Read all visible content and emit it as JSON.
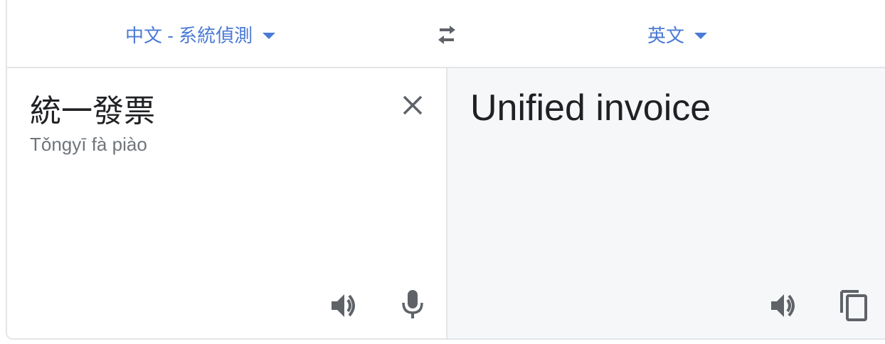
{
  "header": {
    "source_lang": "中文 - 系統偵測",
    "target_lang": "英文",
    "swap_icon": "swap-arrows-icon"
  },
  "source": {
    "text": "統一發票",
    "transliteration": "Tǒngyī fà piào"
  },
  "target": {
    "text": "Unified invoice"
  },
  "icons": {
    "clear": "close-icon",
    "listen": "speaker-icon",
    "microphone": "microphone-icon",
    "copy": "copy-icon"
  },
  "colors": {
    "accent": "#4b7ad6",
    "text": "#202124",
    "muted": "#70757a",
    "icon": "#5f6368",
    "target_bg": "#f6f7f9",
    "border": "#e3e5e8"
  }
}
